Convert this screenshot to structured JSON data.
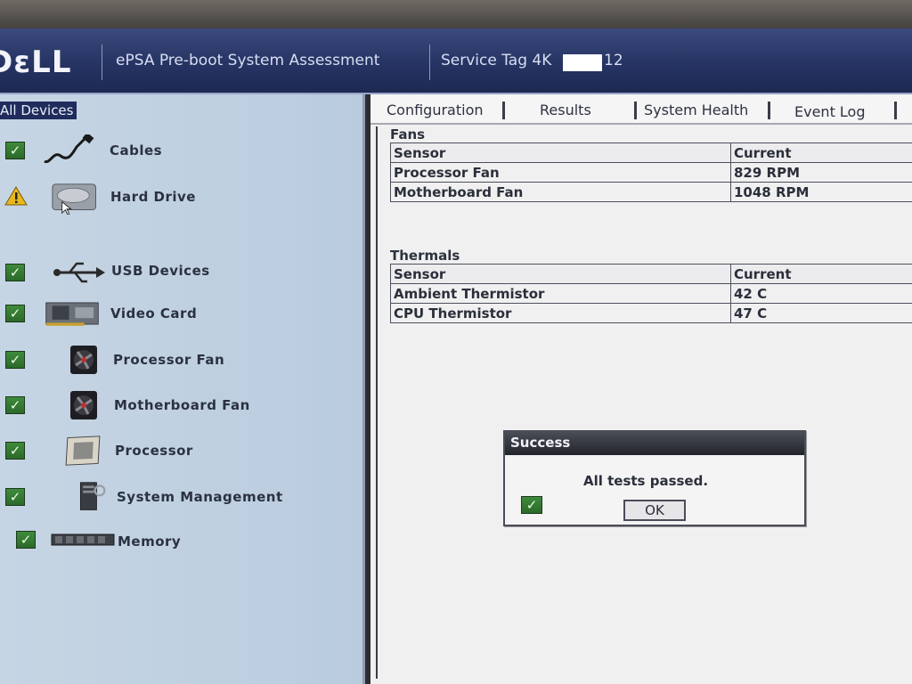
{
  "header": {
    "logo": "DεLL",
    "title": "ePSA Pre-boot System Assessment",
    "service_tag_prefix": "Service Tag 4K",
    "service_tag_suffix": "12"
  },
  "left_panel": {
    "all_devices": "All Devices",
    "devices": [
      {
        "label": "Cables",
        "status": "pass",
        "icon": "cable-icon"
      },
      {
        "label": "Hard Drive",
        "status": "warning",
        "icon": "hard-drive-icon"
      },
      {
        "label": "USB Devices",
        "status": "pass",
        "icon": "usb-icon"
      },
      {
        "label": "Video Card",
        "status": "pass",
        "icon": "video-card-icon"
      },
      {
        "label": "Processor Fan",
        "status": "pass",
        "icon": "fan-icon"
      },
      {
        "label": "Motherboard Fan",
        "status": "pass",
        "icon": "fan-icon"
      },
      {
        "label": "Processor",
        "status": "pass",
        "icon": "processor-icon"
      },
      {
        "label": "System Management",
        "status": "pass",
        "icon": "system-management-icon"
      },
      {
        "label": "Memory",
        "status": "pass",
        "icon": "memory-icon"
      }
    ]
  },
  "tabs": [
    "Configuration",
    "Results",
    "System Health",
    "Event Log"
  ],
  "fans": {
    "title": "Fans",
    "headers": [
      "Sensor",
      "Current"
    ],
    "rows": [
      [
        "Processor Fan",
        "829 RPM"
      ],
      [
        "Motherboard Fan",
        "1048 RPM"
      ]
    ]
  },
  "thermals": {
    "title": "Thermals",
    "headers": [
      "Sensor",
      "Current"
    ],
    "rows": [
      [
        "Ambient Thermistor",
        "42 C"
      ],
      [
        "CPU Thermistor",
        "47 C"
      ]
    ]
  },
  "dialog": {
    "title": "Success",
    "message": "All tests passed.",
    "ok_label": "OK"
  },
  "colors": {
    "header_blue": "#263464",
    "panel_blue": "#c6d5e4",
    "check_green": "#3f8a3d",
    "warning_yellow": "#e8b820"
  }
}
